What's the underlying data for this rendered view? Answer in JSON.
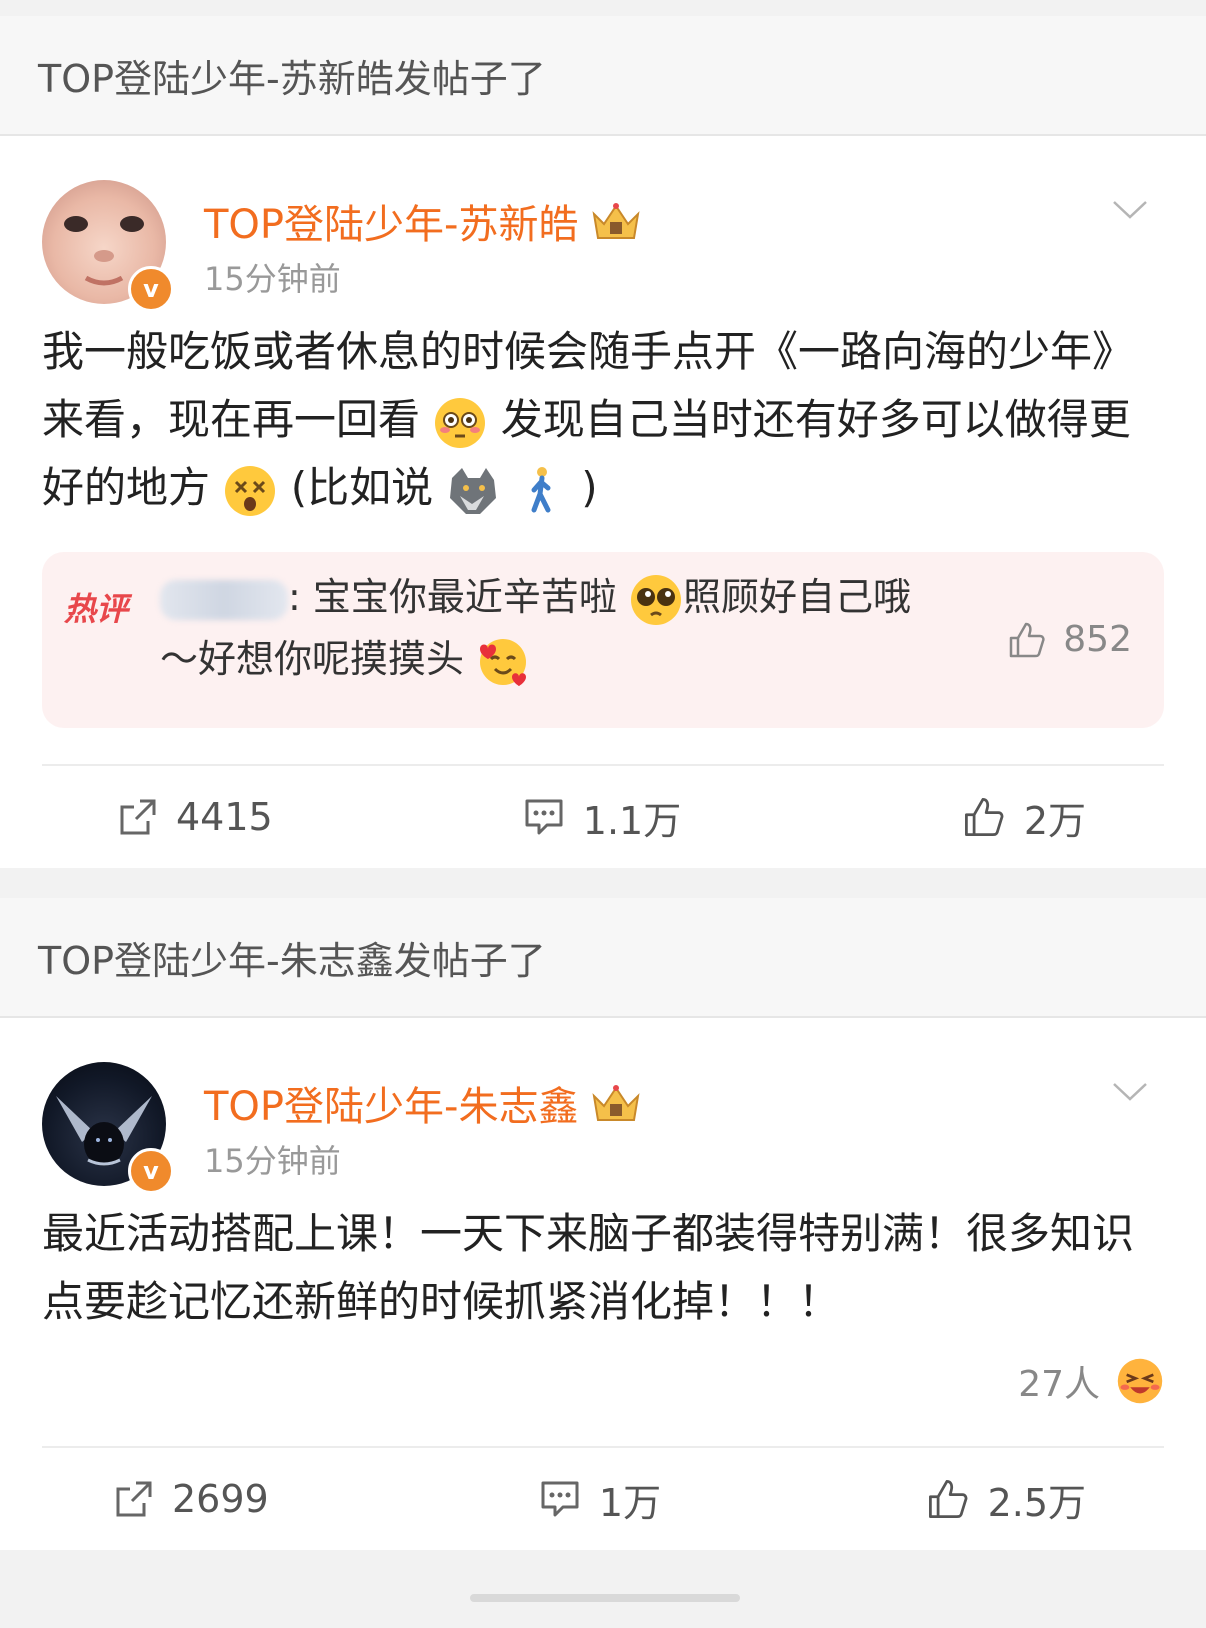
{
  "posts": [
    {
      "header": "TOP登陆少年-苏新皓发帖子了",
      "author": "TOP登陆少年-苏新皓",
      "time": "15分钟前",
      "text_1": "我一般吃饭或者休息的时候会随手点开《一路向海的少年》来看，现在再一回看",
      "text_2": "发现自己当时还有好多可以做得更好的地方",
      "text_3": "(比如说",
      "text_4": ")",
      "hot_comment": {
        "tag": "热评",
        "text_1": ": 宝宝你最近辛苦啦",
        "text_2": "照顾好自己哦～好想你呢摸摸头",
        "likes": "852"
      },
      "actions": {
        "repost": "4415",
        "comment": "1.1万",
        "like": "2万"
      }
    },
    {
      "header": "TOP登陆少年-朱志鑫发帖子了",
      "author": "TOP登陆少年-朱志鑫",
      "time": "15分钟前",
      "text": "最近活动搭配上课！一天下来脑子都装得特别满！很多知识点要趁记忆还新鲜的时候抓紧消化掉！！！",
      "reactions": "27人",
      "actions": {
        "repost": "2699",
        "comment": "1万",
        "like": "2.5万"
      }
    }
  ],
  "colors": {
    "accent": "#f26d1f",
    "hot_tag": "#e8474b",
    "hot_bg": "#fdf1f1"
  },
  "icons": [
    "crown-icon",
    "verified-icon",
    "chevron-down-icon",
    "repost-icon",
    "comment-icon",
    "thumbs-up-icon",
    "emoji-flushed",
    "emoji-dizzy",
    "emoji-wolf",
    "emoji-walking-man",
    "emoji-pleading",
    "emoji-smiling-hearts",
    "emoji-lol"
  ]
}
